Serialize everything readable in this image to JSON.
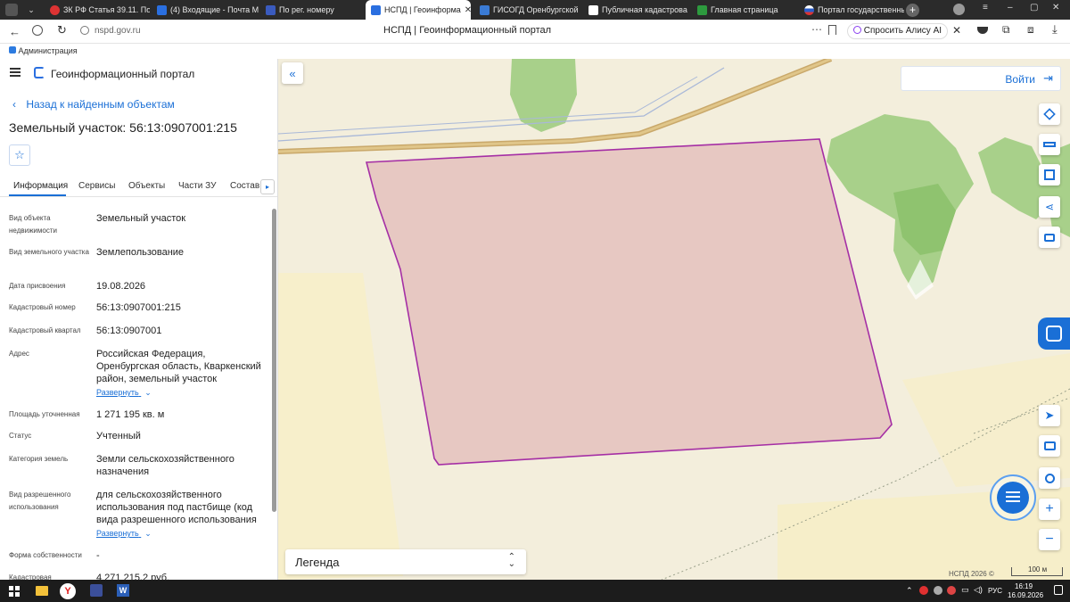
{
  "browser": {
    "tabs": [
      {
        "label": "ЗК РФ Статья 39.11. Пор"
      },
      {
        "label": "(4) Входящие - Почта М"
      },
      {
        "label": "По рег. номеру"
      },
      {
        "label": "НСПД | Геоинформа"
      },
      {
        "label": "ГИСОГД Оренбургской"
      },
      {
        "label": "Публичная кадастрова"
      },
      {
        "label": "Главная страница"
      },
      {
        "label": "Портал государственны"
      }
    ],
    "url": "nspd.gov.ru",
    "page_title": "НСПД | Геоинформационный портал",
    "alice": "Спросить Алису AI",
    "bookmark": "Администрация"
  },
  "app": {
    "title": "Геоинформационный портал",
    "back": "Назад к найденным объектам",
    "object_title": "Земельный участок: 56:13:0907001:215",
    "tabs": [
      "Информация",
      "Сервисы",
      "Объекты",
      "Части ЗУ",
      "Состав"
    ]
  },
  "info": [
    {
      "label": "Вид объекта недвижимости",
      "value": "Земельный участок"
    },
    {
      "label": "Вид земельного участка",
      "value": "Землепользование"
    },
    {
      "label": "Дата присвоения",
      "value": "19.08.2026"
    },
    {
      "label": "Кадастровый номер",
      "value": "56:13:0907001:215"
    },
    {
      "label": "Кадастровый квартал",
      "value": "56:13:0907001"
    },
    {
      "label": "Адрес",
      "value": "Российская Федерация, Оренбургская область, Кваркенский район, земельный участок"
    },
    {
      "label": "Площадь уточненная",
      "value": "1 271 195 кв. м"
    },
    {
      "label": "Статус",
      "value": "Учтенный"
    },
    {
      "label": "Категория земель",
      "value": "Земли сельскохозяйственного назначения"
    },
    {
      "label": "Вид разрешенного использования",
      "value": "для сельскохозяйственного использования под пастбище (код вида разрешенного использования"
    },
    {
      "label": "Форма собственности",
      "value": "-"
    },
    {
      "label": "Кадастровая",
      "value": "4 271 215,2 руб."
    }
  ],
  "expand_label": "Развернуть",
  "map": {
    "login": "Войти",
    "legend": "Легенда",
    "copyright": "НСПД 2026 ©",
    "scale": "100 м"
  },
  "taskbar": {
    "lang": "РУС",
    "time": "16:19",
    "date": "16.09.2026"
  },
  "colors": {
    "parcel_fill": "#e5c3bf",
    "parcel_stroke": "#a52fa5",
    "accent": "#1a6fd6",
    "forest": "#a8d08a"
  }
}
